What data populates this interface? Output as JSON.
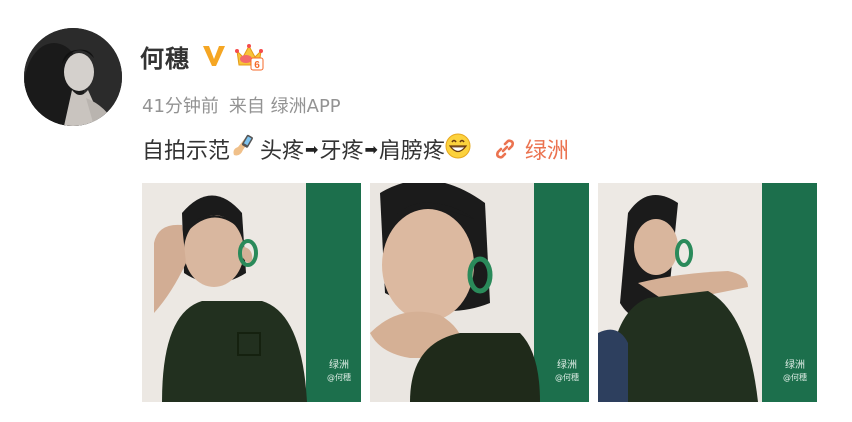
{
  "post": {
    "username": "何穗",
    "verified_icon": "verified-v-icon",
    "vip_icon": "vip-crown-level-6-icon",
    "vip_level": "6",
    "time": "41分钟前",
    "source": "来自 绿洲APP",
    "content": {
      "text_1": "自拍示范",
      "emoji_1": "phone-emoji",
      "text_2": "头疼",
      "arrow": "➡",
      "text_3": "牙疼",
      "text_4": "肩膀疼",
      "emoji_2": "grinning-emoji"
    },
    "link": {
      "icon": "link-chain-icon",
      "label": "绿洲"
    },
    "photos": [
      {
        "name": "photo-1",
        "watermark": "绿洲",
        "watermark_user": "@何穗"
      },
      {
        "name": "photo-2",
        "watermark": "绿洲",
        "watermark_user": "@何穗"
      },
      {
        "name": "photo-3",
        "watermark": "绿洲",
        "watermark_user": "@何穗"
      }
    ]
  },
  "colors": {
    "link": "#eb7350",
    "meta_text": "#939393",
    "primary_text": "#333333",
    "verified": "#f5a623",
    "photo_green": "#1c6f4c"
  }
}
